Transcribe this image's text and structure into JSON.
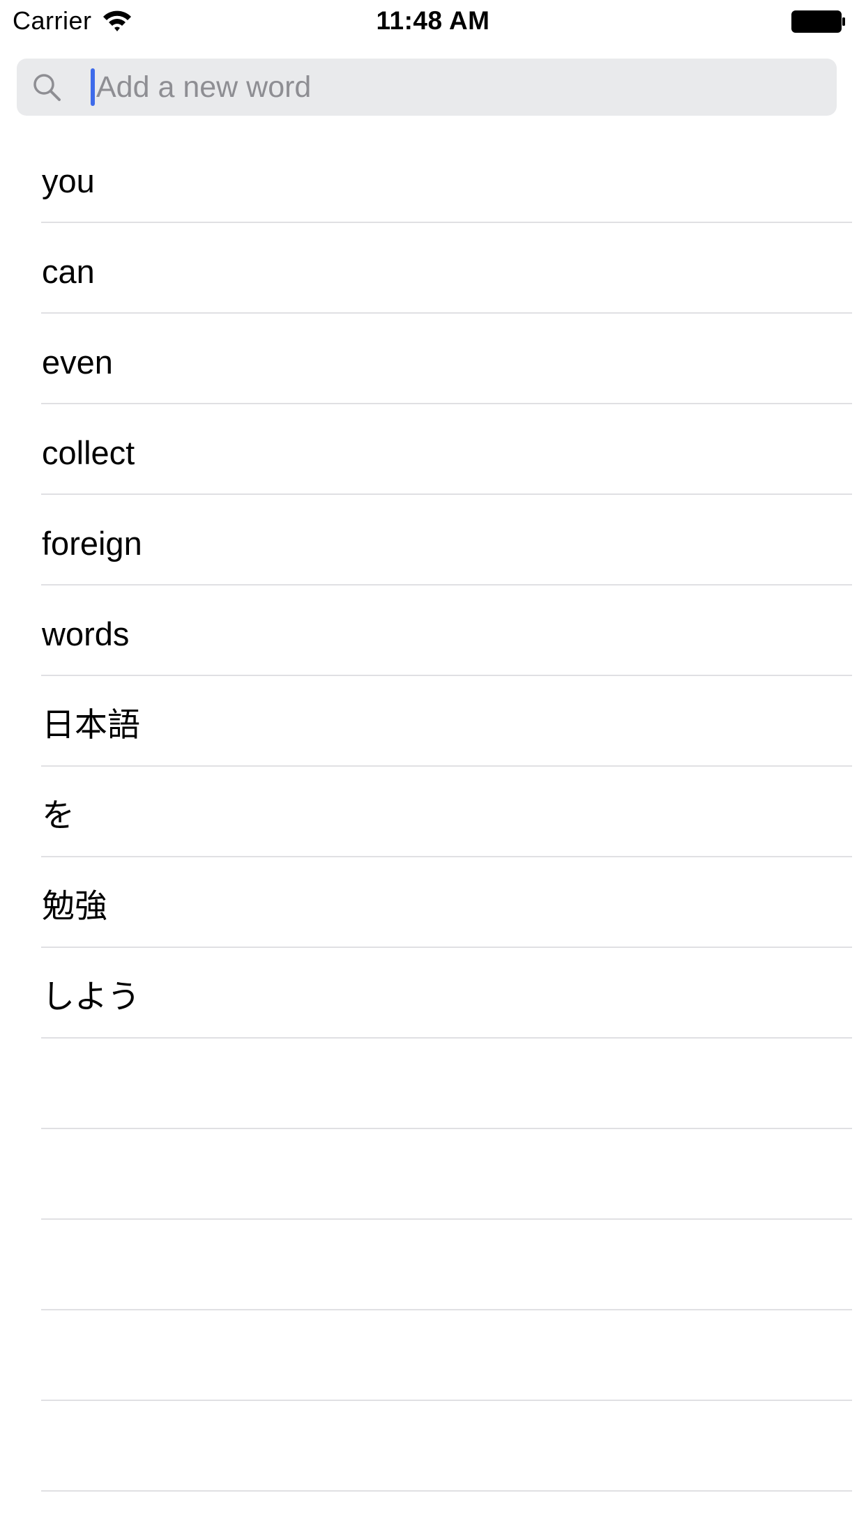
{
  "status_bar": {
    "carrier": "Carrier",
    "time": "11:48 AM",
    "icons": [
      "wifi-icon",
      "battery-icon"
    ]
  },
  "search": {
    "placeholder": "Add a new word",
    "value": "",
    "icon": "search-icon",
    "cursor_color": "#3e6bea"
  },
  "words": [
    "you",
    "can",
    "even",
    "collect",
    "foreign",
    "words",
    "日本語",
    "を",
    "勉強",
    "しよう"
  ],
  "empty_row_count": 5,
  "colors": {
    "search_background": "#e9eaec",
    "separator": "#e0e0e3",
    "placeholder": "#8e8e93"
  }
}
